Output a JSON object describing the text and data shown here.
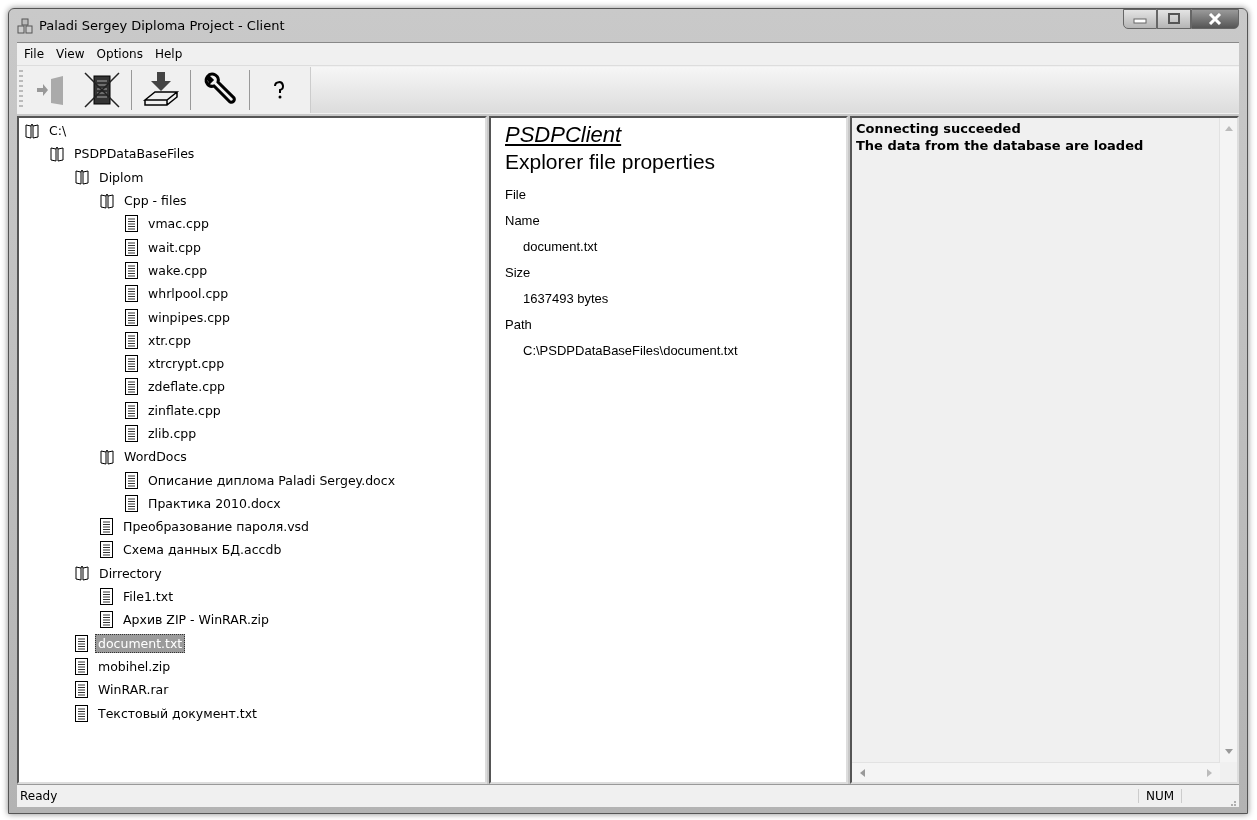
{
  "window": {
    "title": "Paladi Sergey Diploma Project - Client"
  },
  "menu": [
    {
      "label": "File"
    },
    {
      "label": "View"
    },
    {
      "label": "Options"
    },
    {
      "label": "Help"
    }
  ],
  "toolbar": [
    {
      "kind": "connect",
      "disabled": true
    },
    {
      "kind": "disconnect",
      "disabled": false
    },
    {
      "kind": "download",
      "disabled": false
    },
    {
      "kind": "settings",
      "disabled": false
    },
    {
      "kind": "help",
      "disabled": false
    }
  ],
  "tree": [
    {
      "kind": "folder",
      "label": "C:\\",
      "selected": false,
      "children": [
        {
          "kind": "folder",
          "label": "PSDPDataBaseFiles",
          "selected": false,
          "children": [
            {
              "kind": "folder",
              "label": "Diplom",
              "selected": false,
              "children": [
                {
                  "kind": "folder",
                  "label": "Cpp - files",
                  "selected": false,
                  "children": [
                    {
                      "kind": "file",
                      "label": "vmac.cpp",
                      "selected": false
                    },
                    {
                      "kind": "file",
                      "label": "wait.cpp",
                      "selected": false
                    },
                    {
                      "kind": "file",
                      "label": "wake.cpp",
                      "selected": false
                    },
                    {
                      "kind": "file",
                      "label": "whrlpool.cpp",
                      "selected": false
                    },
                    {
                      "kind": "file",
                      "label": "winpipes.cpp",
                      "selected": false
                    },
                    {
                      "kind": "file",
                      "label": "xtr.cpp",
                      "selected": false
                    },
                    {
                      "kind": "file",
                      "label": "xtrcrypt.cpp",
                      "selected": false
                    },
                    {
                      "kind": "file",
                      "label": "zdeflate.cpp",
                      "selected": false
                    },
                    {
                      "kind": "file",
                      "label": "zinflate.cpp",
                      "selected": false
                    },
                    {
                      "kind": "file",
                      "label": "zlib.cpp",
                      "selected": false
                    }
                  ]
                },
                {
                  "kind": "folder",
                  "label": "WordDocs",
                  "selected": false,
                  "children": [
                    {
                      "kind": "file",
                      "label": "Описание диплома Paladi Sergey.docx",
                      "selected": false
                    },
                    {
                      "kind": "file",
                      "label": "Практика 2010.docx",
                      "selected": false
                    }
                  ]
                },
                {
                  "kind": "file",
                  "label": "Преобразование пароля.vsd",
                  "selected": false
                },
                {
                  "kind": "file",
                  "label": "Схема данных БД.accdb",
                  "selected": false
                }
              ]
            },
            {
              "kind": "folder",
              "label": "Dirrectory",
              "selected": false,
              "children": [
                {
                  "kind": "file",
                  "label": "File1.txt",
                  "selected": false
                },
                {
                  "kind": "file",
                  "label": "Архив ZIP - WinRAR.zip",
                  "selected": false
                }
              ]
            },
            {
              "kind": "file",
              "label": "document.txt",
              "selected": true
            },
            {
              "kind": "file",
              "label": "mobihel.zip",
              "selected": false
            },
            {
              "kind": "file",
              "label": "WinRAR.rar",
              "selected": false
            },
            {
              "kind": "file",
              "label": "Текстовый документ.txt",
              "selected": false
            }
          ]
        }
      ]
    }
  ],
  "properties": {
    "app_name": "PSDPClient",
    "heading": "Explorer file properties",
    "section": "File",
    "fields": [
      {
        "label": "Name",
        "value": "document.txt"
      },
      {
        "label": "Size",
        "value": "1637493 bytes"
      },
      {
        "label": "Path",
        "value": "C:\\PSDPDataBaseFiles\\document.txt"
      }
    ]
  },
  "log": [
    "Connecting succeeded",
    "The data from the database are loaded"
  ],
  "status_bar": {
    "message": "Ready",
    "indicator": "NUM"
  }
}
